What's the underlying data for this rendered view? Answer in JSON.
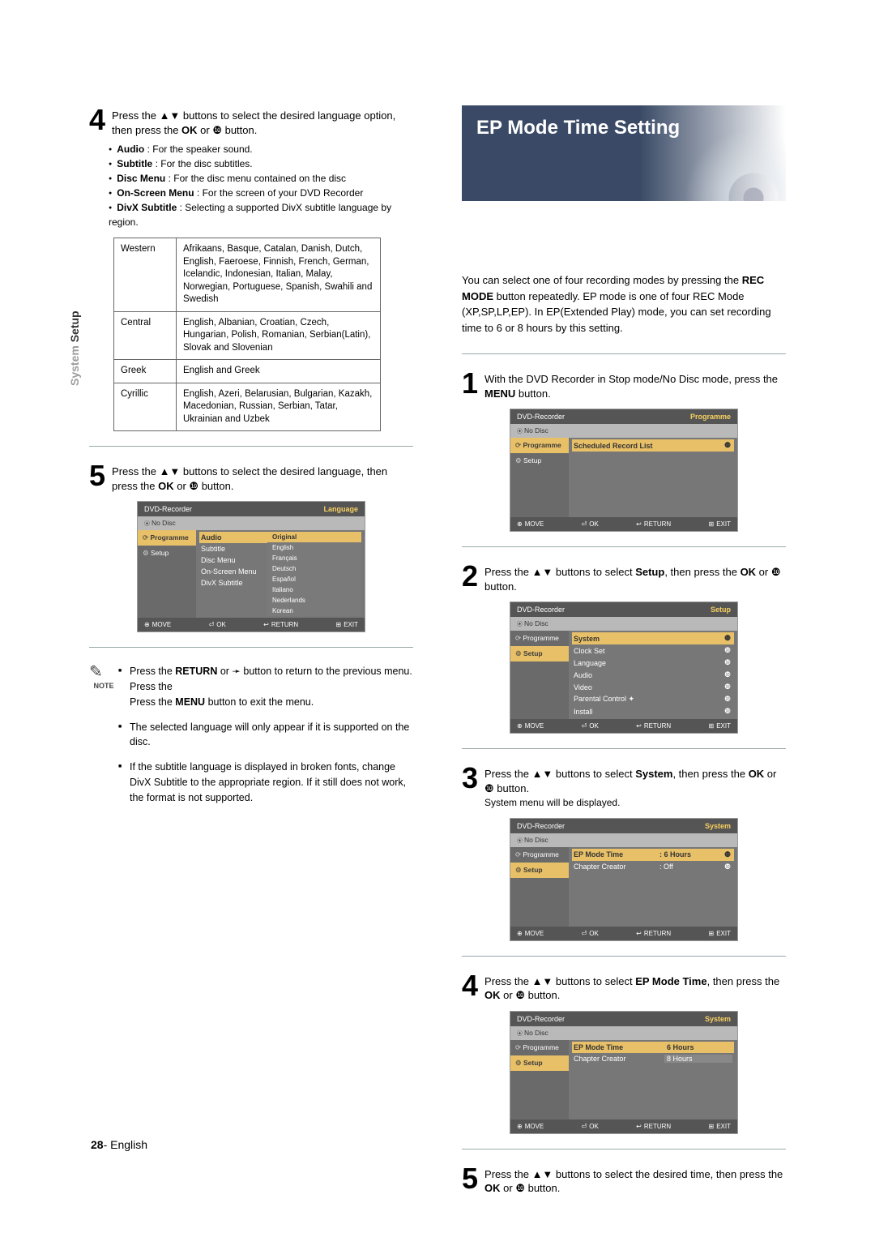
{
  "sidetab": {
    "light": "System ",
    "dark": "Setup"
  },
  "footer": {
    "page": "28",
    "sep": "- ",
    "lang": "English"
  },
  "icons": {
    "updown": "▲▼",
    "right": "❿",
    "left": "➛"
  },
  "left": {
    "step4": {
      "num": "4",
      "text_parts": [
        "Press the ",
        " buttons to select the desired language option, then press the ",
        "OK",
        " or ",
        " button."
      ]
    },
    "bullets": [
      {
        "b": "Audio",
        "t": " : For the speaker sound."
      },
      {
        "b": "Subtitle",
        "t": " : For the disc subtitles."
      },
      {
        "b": "Disc Menu",
        "t": " : For the disc menu contained on the disc"
      },
      {
        "b": "On-Screen Menu",
        "t": " : For the screen of your DVD Recorder"
      },
      {
        "b": "DivX Subtitle",
        "t": " : Selecting a supported DivX subtitle language by region."
      }
    ],
    "regions": [
      {
        "name": "Western",
        "langs": "Afrikaans, Basque, Catalan, Danish, Dutch, English, Faeroese, Finnish, French, German, Icelandic, Indonesian, Italian, Malay, Norwegian, Portuguese, Spanish, Swahili and Swedish"
      },
      {
        "name": "Central",
        "langs": "English, Albanian, Croatian, Czech, Hungarian, Polish, Romanian, Serbian(Latin), Slovak and Slovenian"
      },
      {
        "name": "Greek",
        "langs": "English and Greek"
      },
      {
        "name": "Cyrillic",
        "langs": "English, Azeri, Belarusian, Bulgarian, Kazakh, Macedonian, Russian, Serbian, Tatar, Ukrainian and Uzbek"
      }
    ],
    "step5": {
      "num": "5",
      "text_parts": [
        "Press the ",
        " buttons to select the desired language, then press the ",
        "OK",
        " or ",
        " button."
      ]
    },
    "osd5": {
      "title": "DVD-Recorder",
      "corner": "Language",
      "sub": "No Disc",
      "side": [
        {
          "t": "Programme",
          "cls": "icon hi"
        },
        {
          "t": "Setup",
          "cls": "gear"
        }
      ],
      "rows": [
        "Audio",
        "Subtitle",
        "Disc Menu",
        "On-Screen Menu",
        "DivX Subtitle"
      ],
      "opts": [
        "Original",
        "English",
        "Français",
        "Deutsch",
        "Español",
        "Italiano",
        "Nederlands",
        "Korean"
      ],
      "foot": [
        "MOVE",
        "OK",
        "RETURN",
        "EXIT"
      ]
    },
    "note": {
      "icon": "✎",
      "label": "NOTE",
      "items": [
        {
          "text_parts": [
            "Press the ",
            "RETURN",
            " or ",
            " button to return to the previous menu. Press the ",
            "MENU",
            " button to exit the menu."
          ],
          "left_icon_at": 3
        },
        {
          "text": "The selected language will only appear if it is supported on the disc."
        },
        {
          "text": "If the subtitle language is displayed in broken fonts, change DivX Subtitle to the appropriate region. If it still does not work, the format is not supported."
        }
      ]
    }
  },
  "right": {
    "heading": "EP Mode Time Setting",
    "intro_parts": [
      "You can select one of four recording modes by pressing the ",
      "REC MODE",
      " button repeatedly. EP mode is one of four REC Mode (XP,SP,LP,EP). In EP(Extended Play) mode, you can set recording time to 6 or 8 hours by this setting."
    ],
    "step1": {
      "num": "1",
      "parts": [
        "With the DVD Recorder in Stop mode/No Disc mode, press the ",
        "MENU",
        " button."
      ]
    },
    "osd1": {
      "title": "DVD-Recorder",
      "corner": "Programme",
      "sub": "No Disc",
      "side": [
        {
          "t": "Programme",
          "cls": "icon hi"
        },
        {
          "t": "Setup",
          "cls": "gear"
        }
      ],
      "rows": [
        {
          "k": "Scheduled Record List",
          "v": "",
          "arrow": "❿",
          "sel": true
        }
      ],
      "foot": [
        "MOVE",
        "OK",
        "RETURN",
        "EXIT"
      ]
    },
    "step2": {
      "num": "2",
      "parts": [
        "Press the ",
        " buttons to select ",
        "Setup",
        ", then press the ",
        "OK",
        " or ",
        " button."
      ]
    },
    "osd2": {
      "title": "DVD-Recorder",
      "corner": "Setup",
      "sub": "No Disc",
      "side": [
        {
          "t": "Programme",
          "cls": "icon"
        },
        {
          "t": "Setup",
          "cls": "gear hi"
        }
      ],
      "rows": [
        {
          "k": "System",
          "arrow": "❿",
          "sel": true
        },
        {
          "k": "Clock Set",
          "arrow": "❿"
        },
        {
          "k": "Language",
          "arrow": "❿"
        },
        {
          "k": "Audio",
          "arrow": "❿"
        },
        {
          "k": "Video",
          "arrow": "❿"
        },
        {
          "k": "Parental Control ✦",
          "arrow": "❿"
        },
        {
          "k": "Install",
          "arrow": "❿"
        }
      ],
      "foot": [
        "MOVE",
        "OK",
        "RETURN",
        "EXIT"
      ]
    },
    "step3": {
      "num": "3",
      "parts": [
        "Press the ",
        " buttons to select ",
        "System",
        ", then press the ",
        "OK",
        " or ",
        " button."
      ],
      "sub": "System menu will be displayed."
    },
    "osd3": {
      "title": "DVD-Recorder",
      "corner": "System",
      "sub": "No Disc",
      "side": [
        {
          "t": "Programme",
          "cls": "icon"
        },
        {
          "t": "Setup",
          "cls": "gear hi"
        }
      ],
      "rows": [
        {
          "k": "EP Mode Time",
          "v": ": 6 Hours",
          "arrow": "❿",
          "sel": true
        },
        {
          "k": "Chapter Creator",
          "v": ": Off",
          "arrow": "❿"
        }
      ],
      "foot": [
        "MOVE",
        "OK",
        "RETURN",
        "EXIT"
      ]
    },
    "step4": {
      "num": "4",
      "parts": [
        "Press the ",
        " buttons to select ",
        "EP Mode Time",
        ", then press the ",
        "OK",
        " or ",
        " button."
      ]
    },
    "osd4": {
      "title": "DVD-Recorder",
      "corner": "System",
      "sub": "No Disc",
      "side": [
        {
          "t": "Programme",
          "cls": "icon"
        },
        {
          "t": "Setup",
          "cls": "gear hi"
        }
      ],
      "rows": [
        {
          "k": "EP Mode Time",
          "v": "6 Hours",
          "sel": true,
          "valsel": true
        },
        {
          "k": "Chapter Creator",
          "v": "8 Hours"
        }
      ],
      "foot": [
        "MOVE",
        "OK",
        "RETURN",
        "EXIT"
      ]
    },
    "step5": {
      "num": "5",
      "parts": [
        "Press the ",
        " buttons to select the desired time, then press the ",
        "OK",
        " or ",
        " button."
      ]
    }
  }
}
